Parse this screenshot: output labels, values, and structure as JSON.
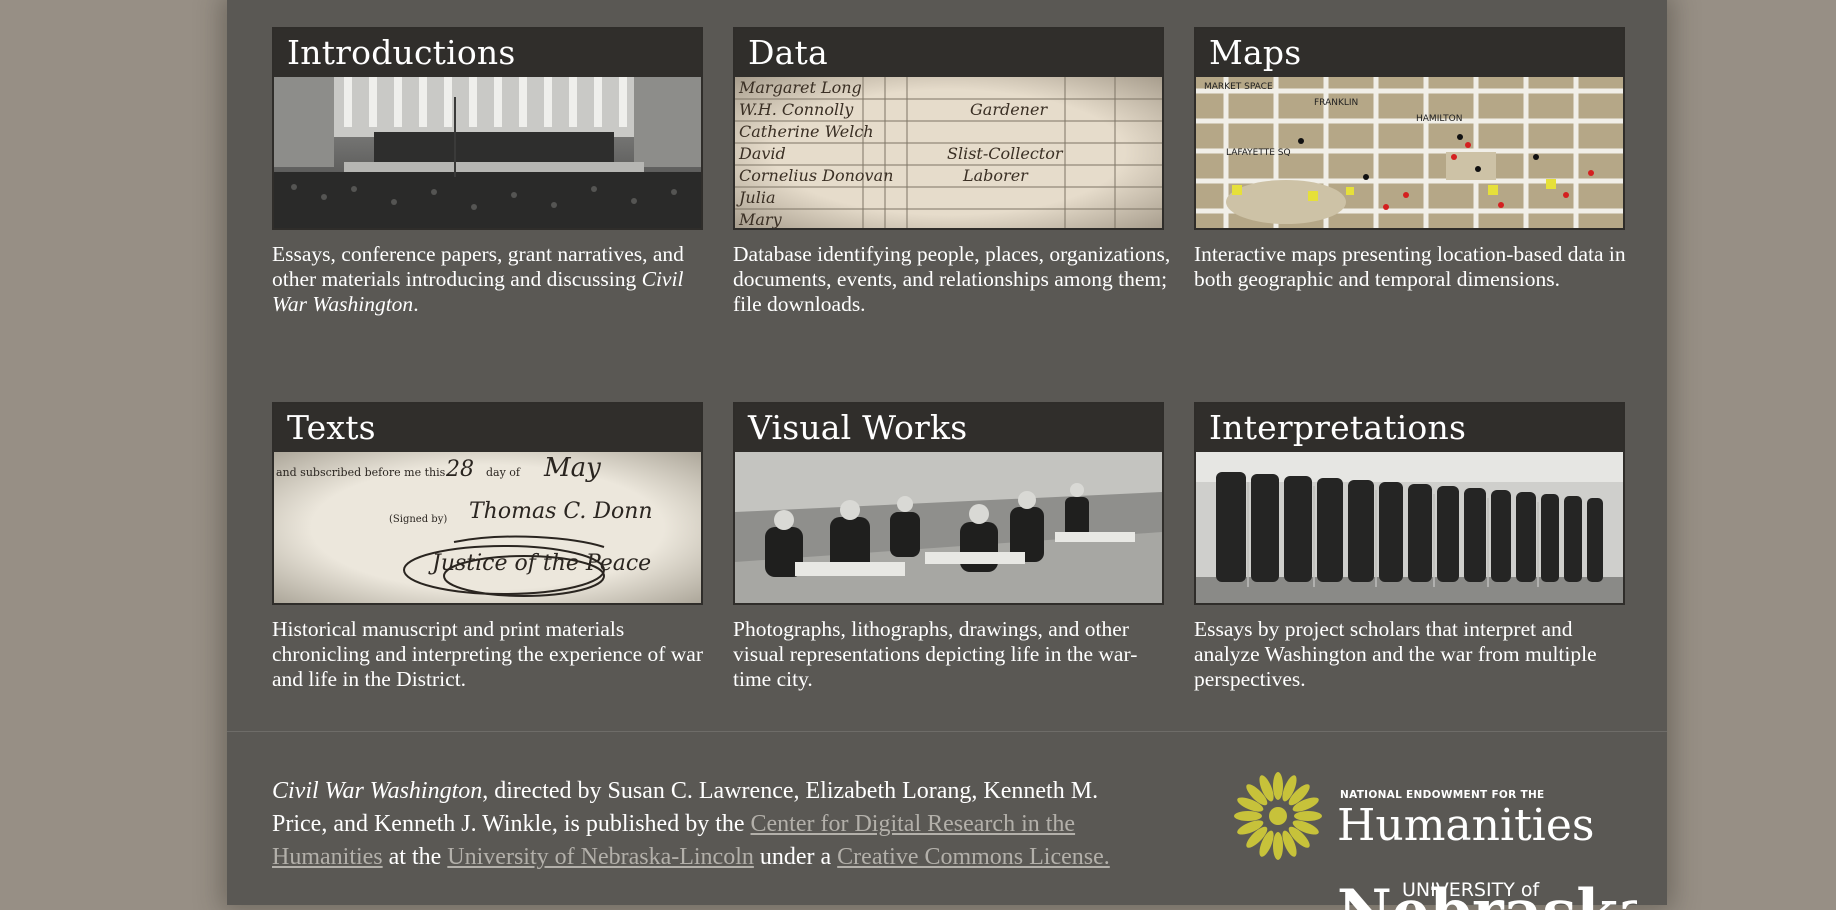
{
  "tiles": [
    {
      "title": "Introductions",
      "desc_pre": "Essays, conference papers, grant narratives, and other materials introducing and discussing ",
      "desc_em": "Civil War Washington",
      "desc_post": "."
    },
    {
      "title": "Data",
      "desc": "Database identifying people, places, organizations, documents, events, and relationships among them; file downloads."
    },
    {
      "title": "Maps",
      "desc": "Interactive maps presenting location-based data in both geographic and temporal dimensions."
    },
    {
      "title": "Texts",
      "desc": "Historical manuscript and print materials chronicling and interpreting the experience of war and life in the District."
    },
    {
      "title": "Visual Works",
      "desc": "Photographs, lithographs, drawings, and other visual representations depicting life in the war-time city."
    },
    {
      "title": "Interpretations",
      "desc": "Essays by project scholars that interpret and analyze Washington and the war from multiple perspectives."
    }
  ],
  "ledger_text": {
    "rows": [
      "Margaret Long",
      "W.H. Connolly",
      "Catherine Welch",
      "David",
      "Cornelius Donovan",
      "Julia",
      "Mary"
    ],
    "occupations": [
      "Gardener",
      "Slist-Collector",
      "Laborer"
    ]
  },
  "manuscript_text": {
    "printed": "and subscribed before me this",
    "day": "28",
    "day_of": "day of",
    "month": "May",
    "signed": "(Signed by)",
    "signature": "Thomas C. Donn",
    "office": "Justice of the Peace"
  },
  "map_labels": [
    "MARKET SPACE",
    "FRANKLIN",
    "HAMILTON",
    "LAFAYETTE SQ"
  ],
  "footer": {
    "title_em": "Civil War Washington",
    "text1": ", directed by Susan C. Lawrence, Elizabeth Lorang, Kenneth M. Price, and Kenneth J. Winkle, is published by the ",
    "link_cdrh": "Center for Digital Research in the Humanities",
    "text2": " at the ",
    "link_unl": "University of Nebraska-Lincoln",
    "text3": " under a ",
    "link_cc": "Creative Commons License."
  },
  "logos": {
    "neh_small": "NATIONAL ENDOWMENT FOR THE",
    "neh_big": "Humanities",
    "unl_small": "UNIVERSITY of",
    "unl_big": "Nebraska"
  },
  "colors": {
    "page_bg": "#5a5854",
    "outer_bg": "#978f85",
    "tile_header": "#302e2b",
    "link": "#b3b0aa",
    "neh_gold": "#c7c23a"
  }
}
